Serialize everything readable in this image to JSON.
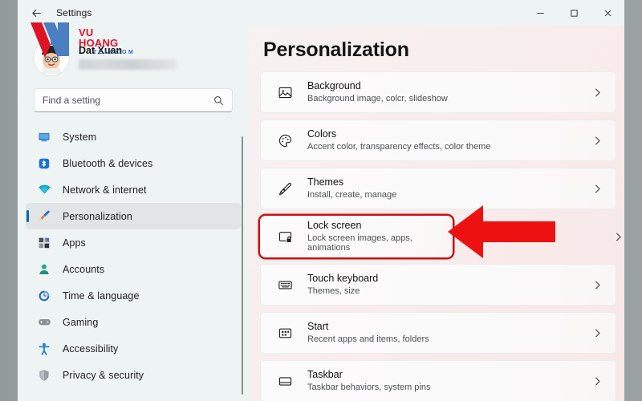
{
  "window": {
    "title": "Settings",
    "back_icon": "back-arrow-icon",
    "controls": [
      {
        "name": "minimize-button",
        "glyph": "minimize-icon"
      },
      {
        "name": "maximize-button",
        "glyph": "maximize-icon"
      },
      {
        "name": "close-button",
        "glyph": "close-icon"
      }
    ]
  },
  "account": {
    "name": "Dat Xuan",
    "email_redacted": true,
    "avatar_icon": "user-avatar-icon"
  },
  "search": {
    "placeholder": "Find a setting",
    "value": "",
    "icon": "search-icon"
  },
  "sidebar": {
    "selected": "Personalization",
    "items": [
      {
        "label": "System",
        "icon": "monitor-icon",
        "selected": false
      },
      {
        "label": "Bluetooth & devices",
        "icon": "bluetooth-icon",
        "selected": false
      },
      {
        "label": "Network & internet",
        "icon": "wifi-icon",
        "selected": false
      },
      {
        "label": "Personalization",
        "icon": "paintbrush-icon",
        "selected": true
      },
      {
        "label": "Apps",
        "icon": "apps-grid-icon",
        "selected": false
      },
      {
        "label": "Accounts",
        "icon": "person-icon",
        "selected": false
      },
      {
        "label": "Time & language",
        "icon": "clock-icon",
        "selected": false
      },
      {
        "label": "Gaming",
        "icon": "gamepad-icon",
        "selected": false
      },
      {
        "label": "Accessibility",
        "icon": "accessibility-icon",
        "selected": false
      },
      {
        "label": "Privacy & security",
        "icon": "shield-icon",
        "selected": false
      }
    ]
  },
  "main": {
    "title": "Personalization",
    "rows": [
      {
        "title": "Background",
        "subtitle": "Background image, colcr, slideshow",
        "icon": "image-icon",
        "highlighted": false
      },
      {
        "title": "Colors",
        "subtitle": "Accent color, transparency effects, color theme",
        "icon": "palette-icon",
        "highlighted": false
      },
      {
        "title": "Themes",
        "subtitle": "Install, create, manage",
        "icon": "paintbrush-icon",
        "highlighted": false
      },
      {
        "title": "Lock screen",
        "subtitle": "Lock screen images, apps, animations",
        "icon": "lock-screen-icon",
        "highlighted": true
      },
      {
        "title": "Touch keyboard",
        "subtitle": "Themes, size",
        "icon": "keyboard-icon",
        "highlighted": false
      },
      {
        "title": "Start",
        "subtitle": "Recent apps and items, folders",
        "icon": "start-menu-icon",
        "highlighted": false
      },
      {
        "title": "Taskbar",
        "subtitle": "Taskbar behaviors, system pins",
        "icon": "taskbar-icon",
        "highlighted": false
      }
    ],
    "chevron_icon": "chevron-right-icon"
  },
  "annotation": {
    "arrow_icon": "left-arrow-annotation",
    "arrow_color": "#ee1111",
    "box_color": "#cc1111",
    "target_row": "Lock screen"
  },
  "watermark": {
    "brand": "VU HOANG",
    "sub": "TELECOM",
    "brand_color": "#e8122a",
    "sub_color": "#2f6fc4"
  }
}
